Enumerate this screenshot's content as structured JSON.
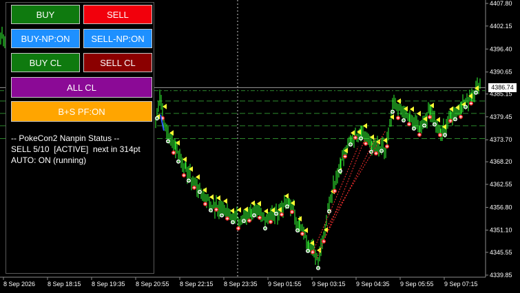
{
  "buttons": {
    "buy": "BUY",
    "sell": "SELL",
    "buy_np": "BUY-NP:ON",
    "sell_np": "SELL-NP:ON",
    "buy_cl": "BUY CL",
    "sell_cl": "SELL CL",
    "all_cl": "ALL CL",
    "bs_pf": "B+S PF:ON"
  },
  "status": {
    "line1": "-- PokeCon2 Nanpin Status --",
    "line2": "SELL 5/10  [ACTIVE]  next in 314pt",
    "line3": "AUTO: ON (running)"
  },
  "colors": {
    "candle": "#33ff33",
    "buy_marker": "#ff2020",
    "sell_marker": "#ffff33",
    "level_line": "#2e8b2e",
    "grid": "#5a5a5a",
    "price_tag_bg": "#ffffff"
  },
  "current_price": "4386.74",
  "price_axis": {
    "labels": [
      "4407.80",
      "4402.15",
      "4396.40",
      "4390.65",
      "4385.15",
      "4379.45",
      "4373.70",
      "4368.20",
      "4362.55",
      "4356.80",
      "4351.10",
      "4345.55",
      "4339.85"
    ],
    "values": [
      4407.8,
      4402.15,
      4396.4,
      4390.65,
      4385.15,
      4379.45,
      4373.7,
      4368.2,
      4362.55,
      4356.8,
      4351.1,
      4345.55,
      4339.85
    ]
  },
  "time_axis": {
    "labels": [
      "8 Sep 2026",
      "8 Sep 18:15",
      "8 Sep 19:35",
      "8 Sep 20:55",
      "8 Sep 22:15",
      "8 Sep 23:35",
      "9 Sep 01:55",
      "9 Sep 03:15",
      "9 Sep 04:35",
      "9 Sep 05:55",
      "9 Sep 07:15"
    ]
  },
  "chart_data": {
    "type": "line",
    "x": [
      "8 Sep 20:55",
      "8 Sep 22:15",
      "8 Sep 23:35",
      "9 Sep 01:55",
      "9 Sep 03:15",
      "9 Sep 04:35",
      "9 Sep 05:55",
      "9 Sep 07:15"
    ],
    "y": [
      4380.0,
      4363.0,
      4356.0,
      4354.0,
      4344.0,
      4377.0,
      4378.0,
      4388.0
    ],
    "level_lines": [
      4386.0,
      4383.4,
      4380.3,
      4377.2,
      4374.0
    ],
    "ylim": [
      4339.85,
      4407.8
    ]
  }
}
